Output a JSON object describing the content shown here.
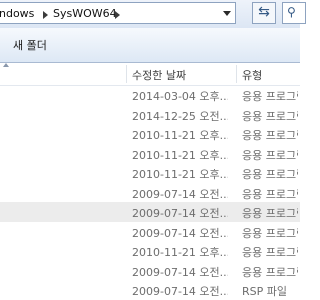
{
  "address": {
    "crumbs": [
      "ndows",
      "SysWOW64"
    ]
  },
  "toolbar": {
    "new_folder": "새 폴더"
  },
  "columns": {
    "modified": "수정한 날짜",
    "type": "유형"
  },
  "rows": [
    {
      "modified": "2014-03-04 오후...",
      "type": "응용 프로그램",
      "selected": false
    },
    {
      "modified": "2014-12-25 오전...",
      "type": "응용 프로그램",
      "selected": false
    },
    {
      "modified": "2010-11-21 오후...",
      "type": "응용 프로그램",
      "selected": false
    },
    {
      "modified": "2010-11-21 오후...",
      "type": "응용 프로그램",
      "selected": false
    },
    {
      "modified": "2010-11-21 오후...",
      "type": "응용 프로그램",
      "selected": false
    },
    {
      "modified": "2009-07-14 오전...",
      "type": "응용 프로그램",
      "selected": false
    },
    {
      "modified": "2009-07-14 오전...",
      "type": "응용 프로그램",
      "selected": true
    },
    {
      "modified": "2009-07-14 오전...",
      "type": "응용 프로그램",
      "selected": false
    },
    {
      "modified": "2010-11-21 오후...",
      "type": "응용 프로그램",
      "selected": false
    },
    {
      "modified": "2009-07-14 오전...",
      "type": "응용 프로그램",
      "selected": false
    },
    {
      "modified": "2009-07-14 오전...",
      "type": "RSP 파일",
      "selected": false
    }
  ]
}
